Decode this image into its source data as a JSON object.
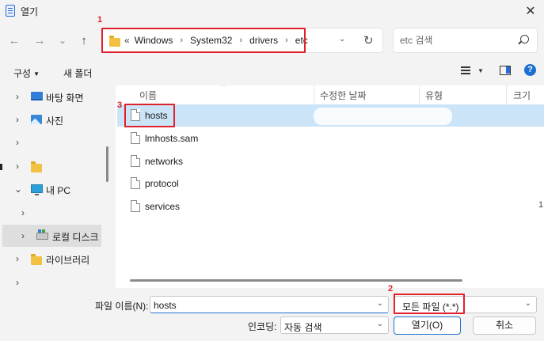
{
  "window": {
    "title": "열기",
    "close_glyph": "✕"
  },
  "nav": {
    "back": "←",
    "forward": "→",
    "history": "⌄",
    "up": "↑"
  },
  "address": {
    "overflow": "«",
    "crumbs": [
      "Windows",
      "System32",
      "drivers",
      "etc"
    ],
    "separator": "›",
    "dropdown": "⌄",
    "refresh": "↻"
  },
  "search": {
    "placeholder": "etc 검색"
  },
  "toolbar": {
    "organize": "구성",
    "organize_caret": "▼",
    "new_folder": "새 폴더",
    "view_caret": "▼",
    "help": "?"
  },
  "sidebar": {
    "chevron_right": "›",
    "chevron_down": "⌄",
    "items": [
      {
        "label": "바탕 화면",
        "icon": "desktop-icon"
      },
      {
        "label": "사진",
        "icon": "pictures-icon"
      },
      {
        "label": "",
        "icon": ""
      },
      {
        "label": "",
        "icon": "folder-icon"
      },
      {
        "label": "내 PC",
        "icon": "pc-icon"
      },
      {
        "label": "",
        "icon": ""
      },
      {
        "label": "로컬 디스크",
        "icon": "drive-icon"
      },
      {
        "label": "라이브러리",
        "icon": "library-folder-icon"
      },
      {
        "label": "",
        "icon": ""
      }
    ]
  },
  "columns": {
    "name": "이름",
    "modified": "수정한 날짜",
    "type": "유형",
    "size": "크기",
    "sort_caret": "^"
  },
  "files": [
    "hosts",
    "lmhosts.sam",
    "networks",
    "protocol",
    "services"
  ],
  "right_edge_text": "1",
  "bottom": {
    "filename_label": "파일 이름(N):",
    "filename_value": "hosts",
    "filter": "모든 파일  (*.*)",
    "encoding_label": "인코딩:",
    "encoding_value": "자동 검색",
    "open_button": "열기(O)",
    "cancel_button": "취소",
    "dropdown": "⌄"
  },
  "steps": {
    "one": "1",
    "two": "2",
    "three": "3"
  },
  "colors": {
    "highlight_red": "#e0202a",
    "accent_blue": "#1d6fd1",
    "selection": "#cce4f7"
  }
}
